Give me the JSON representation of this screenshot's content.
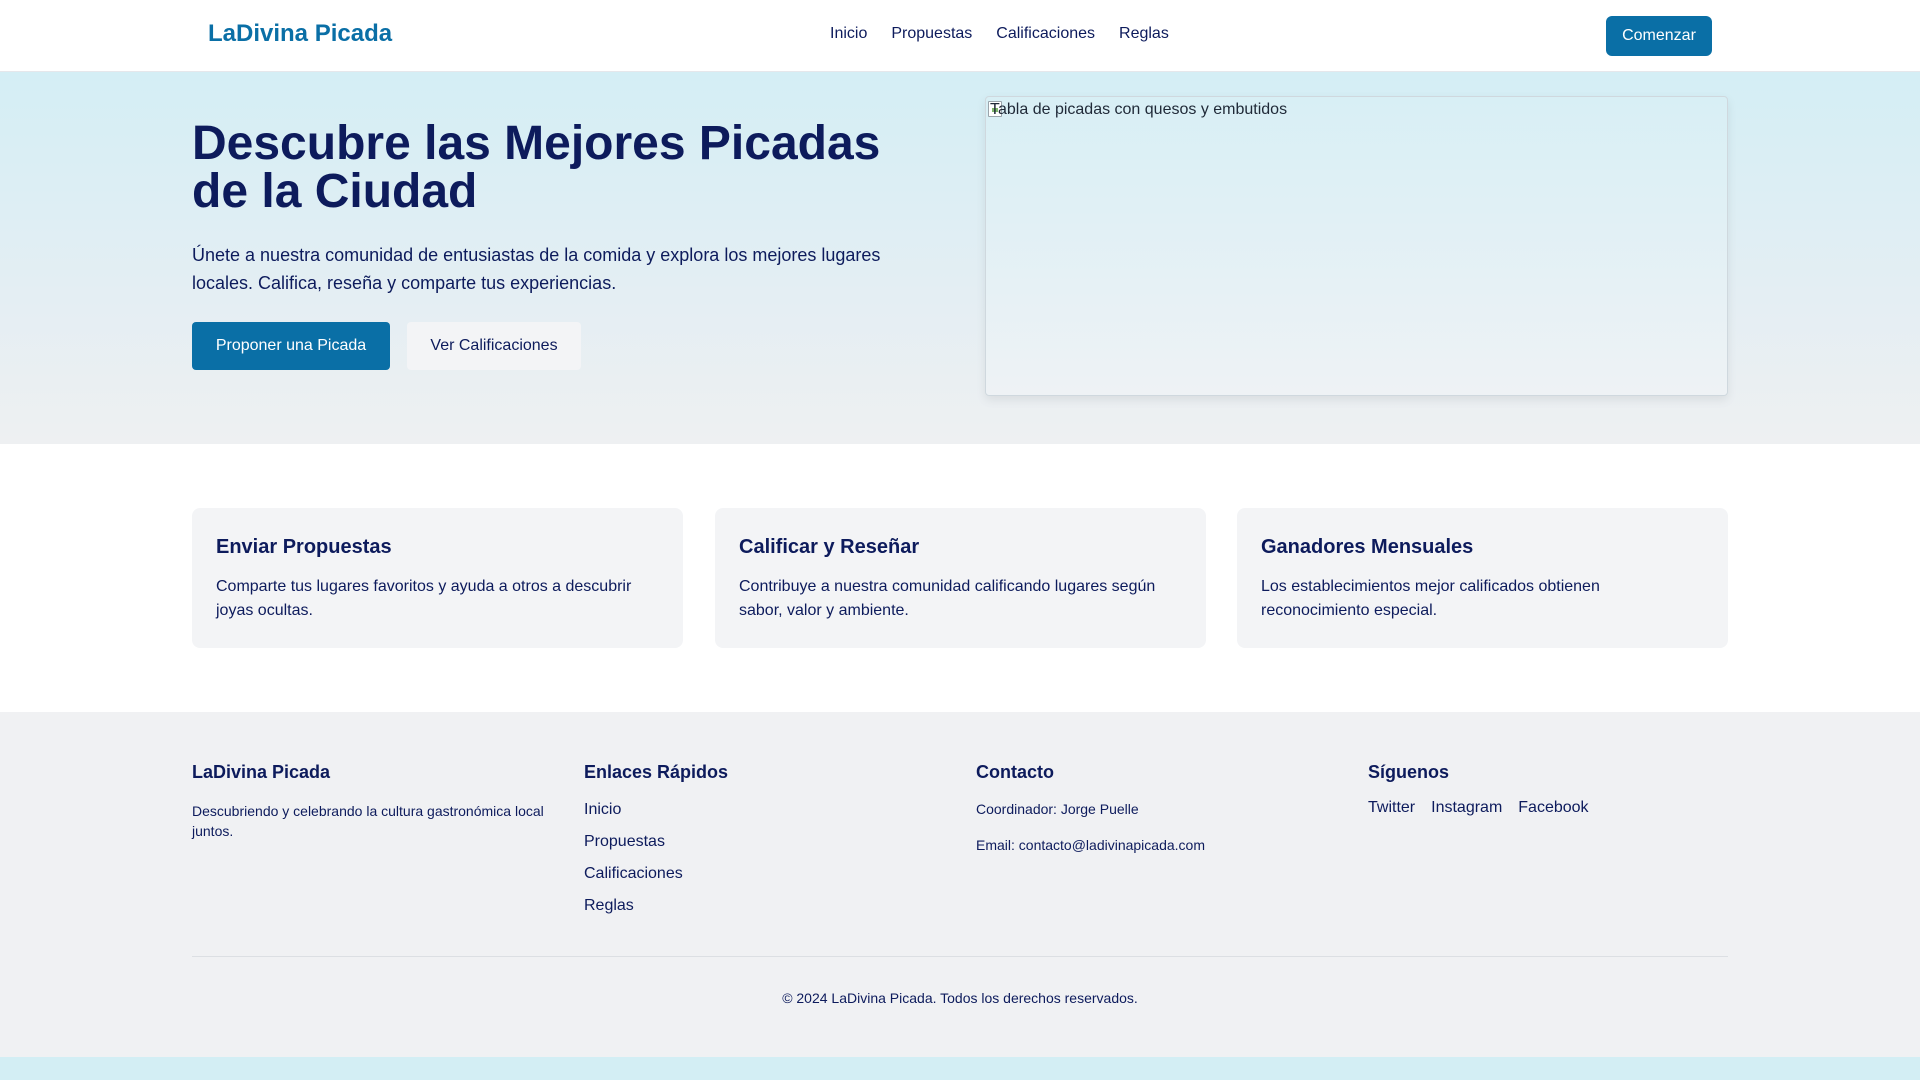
{
  "header": {
    "logo": "LaDivina Picada",
    "nav": [
      "Inicio",
      "Propuestas",
      "Calificaciones",
      "Reglas"
    ],
    "cta": "Comenzar"
  },
  "hero": {
    "title": "Descubre las Mejores Picadas de la Ciudad",
    "description": "Únete a nuestra comunidad de entusiastas de la comida y explora los mejores lugares locales. Califica, reseña y comparte tus experiencias.",
    "primary_button": "Proponer una Picada",
    "secondary_button": "Ver Calificaciones",
    "image_alt": "Tabla de picadas con quesos y embutidos"
  },
  "features": [
    {
      "title": "Enviar Propuestas",
      "text": "Comparte tus lugares favoritos y ayuda a otros a descubrir joyas ocultas."
    },
    {
      "title": "Calificar y Reseñar",
      "text": "Contribuye a nuestra comunidad calificando lugares según sabor, valor y ambiente."
    },
    {
      "title": "Ganadores Mensuales",
      "text": "Los establecimientos mejor calificados obtienen reconocimiento especial."
    }
  ],
  "footer": {
    "about": {
      "title": "LaDivina Picada",
      "text": "Descubriendo y celebrando la cultura gastronómica local juntos."
    },
    "links": {
      "title": "Enlaces Rápidos",
      "items": [
        "Inicio",
        "Propuestas",
        "Calificaciones",
        "Reglas"
      ]
    },
    "contact": {
      "title": "Contacto",
      "coordinator": "Coordinador: Jorge Puelle",
      "email": "Email: contacto@ladivinapicada.com"
    },
    "social": {
      "title": "Síguenos",
      "items": [
        "Twitter",
        "Instagram",
        "Facebook"
      ]
    },
    "copyright": "© 2024 LaDivina Picada. Todos los derechos reservados."
  },
  "colors": {
    "brand": "#0a6fa6",
    "heading": "#0d1b5c",
    "hero_bg": "#d4eef5",
    "card_bg": "#f3f4f6"
  }
}
